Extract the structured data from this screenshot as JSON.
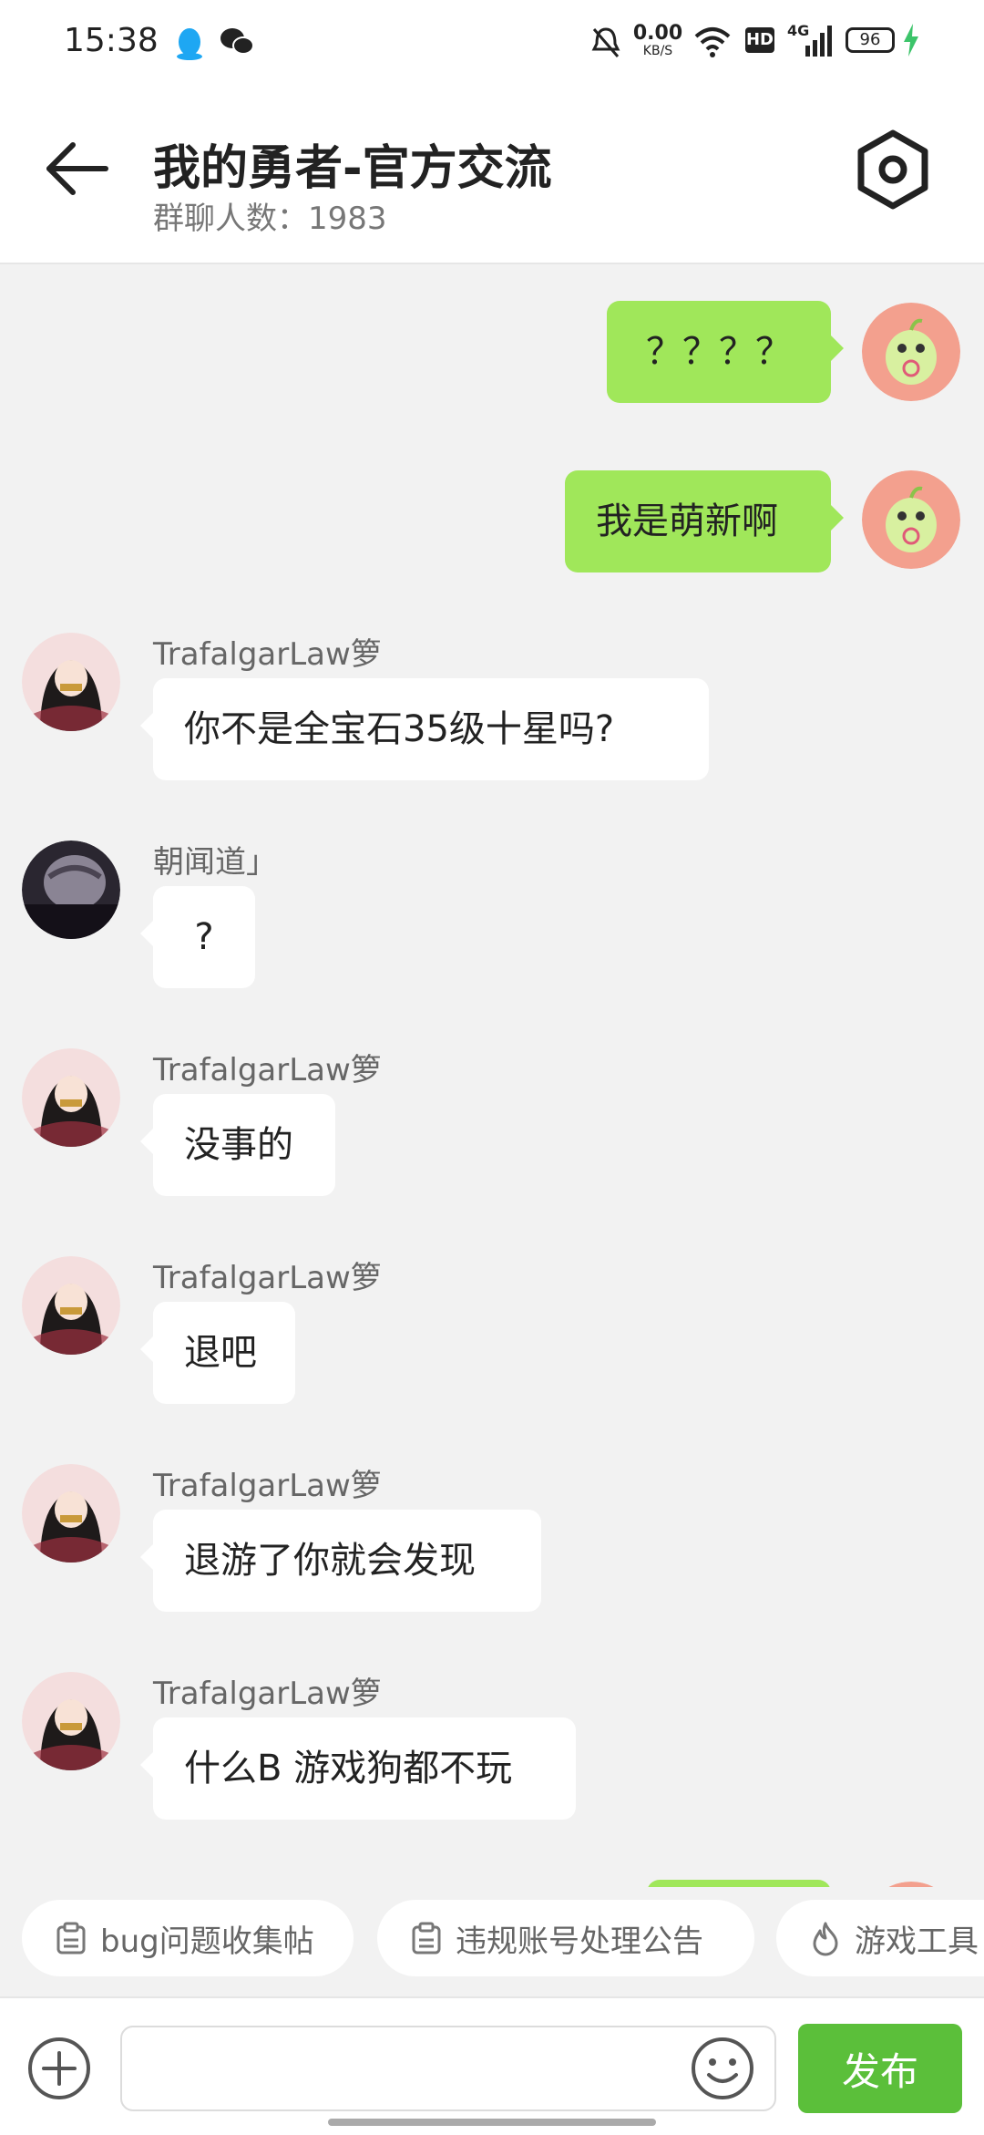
{
  "status_bar": {
    "time": "15:38",
    "speed": "0.00",
    "speed_unit": "KB/S",
    "hd": "HD",
    "network": "4G",
    "battery": "96"
  },
  "header": {
    "title": "我的勇者-官方交流",
    "member_label": "群聊人数：",
    "member_count": "1983"
  },
  "messages": [
    {
      "side": "out",
      "text": "？？？？"
    },
    {
      "side": "out",
      "text": "我是萌新啊"
    },
    {
      "side": "in",
      "sender": "TrafalgarLaw箩",
      "text": "你不是全宝石35级十星吗?"
    },
    {
      "side": "in",
      "sender": "朝闻道」",
      "text": "?"
    },
    {
      "side": "in",
      "sender": "TrafalgarLaw箩",
      "text": "没事的"
    },
    {
      "side": "in",
      "sender": "TrafalgarLaw箩",
      "text": "退吧"
    },
    {
      "side": "in",
      "sender": "TrafalgarLaw箩",
      "text": "退游了你就会发现"
    },
    {
      "side": "in",
      "sender": "TrafalgarLaw箩",
      "text": "什么B 游戏狗都不玩"
    }
  ],
  "quick_links": [
    {
      "label": "bug问题收集帖",
      "icon": "clipboard-icon"
    },
    {
      "label": "违规账号处理公告",
      "icon": "clipboard-icon"
    },
    {
      "label": "游戏工具",
      "icon": "flame-icon"
    }
  ],
  "input": {
    "placeholder": "",
    "publish_label": "发布"
  },
  "colors": {
    "outgoing_bubble": "#a0e75a",
    "publish_button": "#5bbf3a",
    "background": "#f2f2f2"
  }
}
